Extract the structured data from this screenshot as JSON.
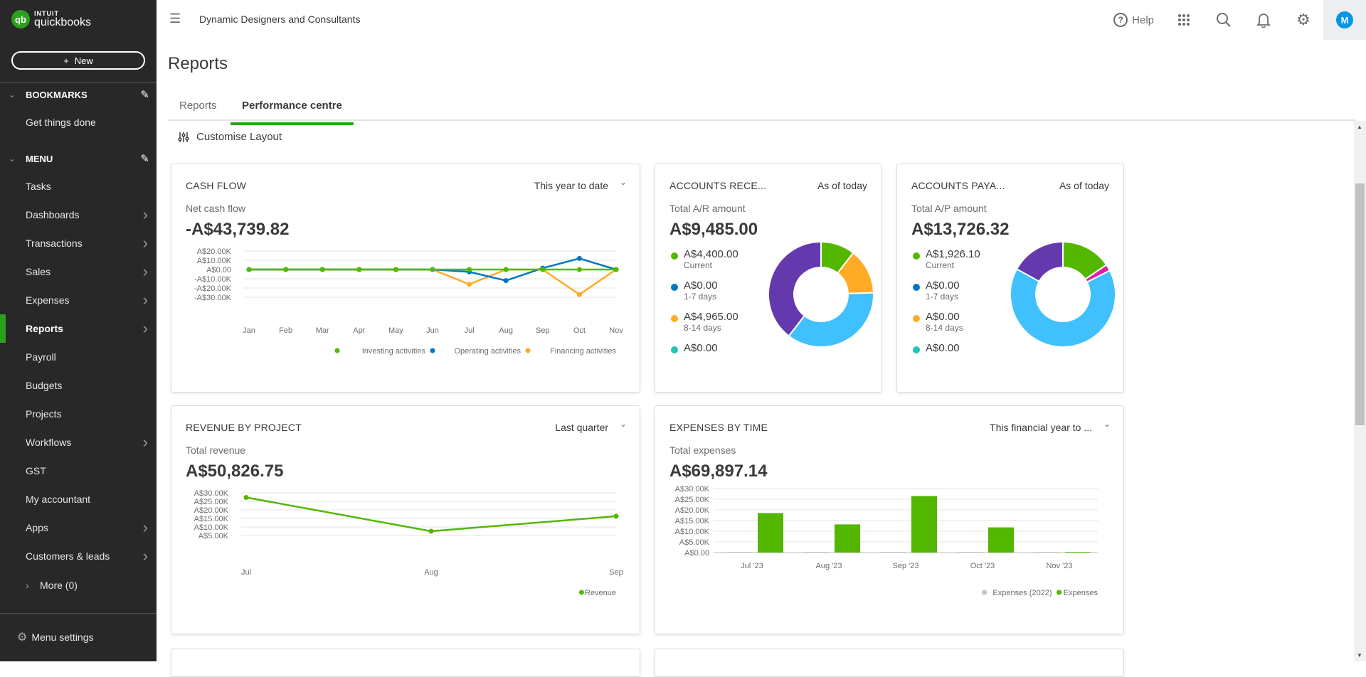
{
  "app": {
    "logo_top": "INTUIT",
    "logo_bottom": "quickbooks",
    "logo_mark": "qb",
    "company": "Dynamic Designers and Consultants"
  },
  "sidebar": {
    "new_label": "New",
    "bookmarks_title": "BOOKMARKS",
    "bookmarks": [
      {
        "label": "Get things done"
      }
    ],
    "menu_title": "MENU",
    "items": [
      {
        "label": "Tasks",
        "has_arrow": false
      },
      {
        "label": "Dashboards",
        "has_arrow": true
      },
      {
        "label": "Transactions",
        "has_arrow": true
      },
      {
        "label": "Sales",
        "has_arrow": true
      },
      {
        "label": "Expenses",
        "has_arrow": true
      },
      {
        "label": "Reports",
        "has_arrow": true,
        "active": true
      },
      {
        "label": "Payroll",
        "has_arrow": false
      },
      {
        "label": "Budgets",
        "has_arrow": false
      },
      {
        "label": "Projects",
        "has_arrow": false
      },
      {
        "label": "Workflows",
        "has_arrow": true
      },
      {
        "label": "GST",
        "has_arrow": false
      },
      {
        "label": "My accountant",
        "has_arrow": false
      },
      {
        "label": "Apps",
        "has_arrow": true
      },
      {
        "label": "Customers & leads",
        "has_arrow": true
      }
    ],
    "more_label": "More (0)",
    "menu_settings_label": "Menu settings"
  },
  "topbar": {
    "help_label": "Help",
    "avatar_initial": "M"
  },
  "page": {
    "title": "Reports",
    "tabs": [
      {
        "label": "Reports",
        "active": false
      },
      {
        "label": "Performance centre",
        "active": true
      }
    ],
    "customise_label": "Customise Layout"
  },
  "colors": {
    "brand_green": "#2ca01c",
    "series_green": "#53b700",
    "series_blue": "#0077c5",
    "series_orange": "#ffab26",
    "teal": "#21c5b7",
    "light_blue": "#40c0fd",
    "purple": "#6339ad",
    "pink": "#e11ea4",
    "gray": "#c3c3c3"
  },
  "cards": {
    "cash_flow": {
      "title": "CASH FLOW",
      "period": "This year to date",
      "sub": "Net cash flow",
      "total": "-A$43,739.82"
    },
    "ar": {
      "title": "ACCOUNTS RECE...",
      "period": "As of today",
      "sub": "Total A/R amount",
      "total": "A$9,485.00",
      "legend": [
        {
          "amount": "A$4,400.00",
          "label": "Current",
          "color": "#53b700"
        },
        {
          "amount": "A$0.00",
          "label": "1-7 days",
          "color": "#0077c5"
        },
        {
          "amount": "A$4,965.00",
          "label": "8-14 days",
          "color": "#ffab26"
        },
        {
          "amount": "A$0.00",
          "label": "",
          "color": "#21c5b7"
        }
      ]
    },
    "ap": {
      "title": "ACCOUNTS PAYA...",
      "period": "As of today",
      "sub": "Total A/P amount",
      "total": "A$13,726.32",
      "legend": [
        {
          "amount": "A$1,926.10",
          "label": "Current",
          "color": "#53b700"
        },
        {
          "amount": "A$0.00",
          "label": "1-7 days",
          "color": "#0077c5"
        },
        {
          "amount": "A$0.00",
          "label": "8-14 days",
          "color": "#ffab26"
        },
        {
          "amount": "A$0.00",
          "label": "",
          "color": "#21c5b7"
        }
      ]
    },
    "revenue": {
      "title": "REVENUE BY PROJECT",
      "period": "Last quarter",
      "sub": "Total revenue",
      "total": "A$50,826.75"
    },
    "expenses": {
      "title": "EXPENSES BY TIME",
      "period": "This financial year to ...",
      "sub": "Total expenses",
      "total": "A$69,897.14"
    }
  },
  "chart_data": [
    {
      "id": "cash_flow",
      "type": "line",
      "title": "CASH FLOW",
      "x": [
        "Jan",
        "Feb",
        "Mar",
        "Apr",
        "May",
        "Jun",
        "Jul",
        "Aug",
        "Sep",
        "Oct",
        "Nov"
      ],
      "ylim": [
        -30000,
        20000
      ],
      "yticks": [
        20000,
        10000,
        0,
        -10000,
        -20000,
        -30000
      ],
      "ytick_labels": [
        "A$20.00K",
        "A$10.00K",
        "A$0.00",
        "-A$10.00K",
        "-A$20.00K",
        "-A$30.00K"
      ],
      "grid": true,
      "legend_position": "bottom-right",
      "series": [
        {
          "name": "Financing activities",
          "color": "#ffab26",
          "values": [
            0,
            0,
            0,
            0,
            0,
            0,
            -16000,
            0,
            0,
            -27000,
            0
          ]
        },
        {
          "name": "Operating activities",
          "color": "#0077c5",
          "values": [
            0,
            0,
            0,
            0,
            0,
            0,
            -2500,
            -12000,
            1500,
            12000,
            0
          ]
        },
        {
          "name": "Investing activities",
          "color": "#53b700",
          "values": [
            0,
            0,
            0,
            0,
            0,
            0,
            0,
            0,
            0,
            0,
            0
          ]
        }
      ],
      "legend_order": [
        "Investing activities",
        "Operating activities",
        "Financing activities"
      ]
    },
    {
      "id": "ar_donut",
      "type": "pie",
      "title": "ACCOUNTS RECEIVABLE",
      "slices": [
        {
          "color": "#53b700",
          "fraction": 0.105
        },
        {
          "color": "#ffab26",
          "fraction": 0.14
        },
        {
          "color": "#40c0fd",
          "fraction": 0.36
        },
        {
          "color": "#6339ad",
          "fraction": 0.395
        }
      ]
    },
    {
      "id": "ap_donut",
      "type": "pie",
      "title": "ACCOUNTS PAYABLE",
      "slices": [
        {
          "color": "#53b700",
          "fraction": 0.155
        },
        {
          "color": "#e11ea4",
          "fraction": 0.02
        },
        {
          "color": "#40c0fd",
          "fraction": 0.655
        },
        {
          "color": "#6339ad",
          "fraction": 0.17
        }
      ]
    },
    {
      "id": "revenue",
      "type": "line",
      "title": "REVENUE BY PROJECT",
      "x": [
        "Jul",
        "Aug",
        "Sep"
      ],
      "ylim": [
        5000,
        30000
      ],
      "yticks": [
        30000,
        25000,
        20000,
        15000,
        10000,
        5000
      ],
      "ytick_labels": [
        "A$30.00K",
        "A$25.00K",
        "A$20.00K",
        "A$15.00K",
        "A$10.00K",
        "A$5.00K"
      ],
      "grid": true,
      "legend_position": "bottom-right",
      "series": [
        {
          "name": "Revenue",
          "color": "#53b700",
          "values": [
            27300,
            7500,
            16300
          ]
        }
      ]
    },
    {
      "id": "expenses",
      "type": "bar",
      "title": "EXPENSES BY TIME",
      "categories": [
        "Jul '23",
        "Aug '23",
        "Sep '23",
        "Oct '23",
        "Nov '23"
      ],
      "ylim": [
        0,
        30000
      ],
      "yticks": [
        30000,
        25000,
        20000,
        15000,
        10000,
        5000,
        0
      ],
      "ytick_labels": [
        "A$30.00K",
        "A$25.00K",
        "A$20.00K",
        "A$15.00K",
        "A$10.00K",
        "A$5.00K",
        "A$0.00"
      ],
      "grid": true,
      "legend_position": "bottom-right",
      "series": [
        {
          "name": "Expenses (2022)",
          "color": "#c3c3c3",
          "values": [
            300,
            300,
            300,
            300,
            300
          ]
        },
        {
          "name": "Expenses",
          "color": "#53b700",
          "values": [
            18500,
            13200,
            26500,
            11800,
            300
          ]
        }
      ]
    }
  ]
}
